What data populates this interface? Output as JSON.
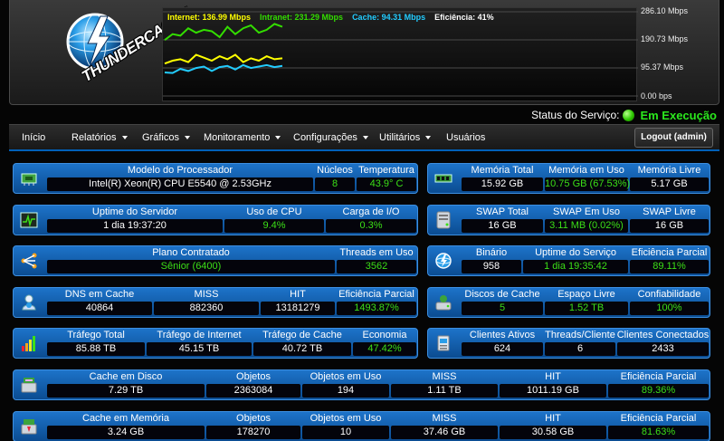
{
  "header": {
    "logo_text": "THUNDERCACHE",
    "graph": {
      "legend": [
        {
          "label": "Internet: 136.99 Mbps",
          "color": "#ffff00"
        },
        {
          "label": "Intranet: 231.29 Mbps",
          "color": "#33dd00"
        },
        {
          "label": "Cache: 94.31 Mbps",
          "color": "#22ccff"
        },
        {
          "label": "Eficiência: 41%",
          "color": "#ffffff"
        }
      ],
      "axis": [
        "286.10 Mbps",
        "190.73 Mbps",
        "95.37 Mbps",
        "0.00 bps"
      ]
    }
  },
  "chart_data": {
    "type": "line",
    "ylim": [
      0,
      286.1
    ],
    "yticks": [
      "286.10 Mbps",
      "190.73 Mbps",
      "95.37 Mbps",
      "0.00 bps"
    ],
    "x": [
      1,
      2,
      3,
      4,
      5,
      6,
      7,
      8,
      9,
      10,
      11,
      12,
      13,
      14,
      15,
      16
    ],
    "series": [
      {
        "name": "Intranet",
        "color": "#33dd00",
        "values": [
          190,
          210,
          205,
          230,
          215,
          225,
          220,
          200,
          235,
          210,
          230,
          240,
          215,
          225,
          245,
          235
        ]
      },
      {
        "name": "Internet",
        "color": "#ffff00",
        "values": [
          110,
          120,
          125,
          115,
          140,
          130,
          120,
          135,
          125,
          140,
          115,
          128,
          120,
          135,
          125,
          128
        ]
      },
      {
        "name": "Cache",
        "color": "#22ccff",
        "values": [
          80,
          78,
          92,
          85,
          95,
          100,
          85,
          98,
          102,
          90,
          105,
          95,
          100,
          105,
          98,
          102
        ]
      }
    ]
  },
  "status": {
    "label": "Status do Serviço:",
    "value": "Em Execução"
  },
  "nav": {
    "items": [
      "Início",
      "Relatórios",
      "Gráficos",
      "Monitoramento",
      "Configurações",
      "Utilitários",
      "Usuários"
    ],
    "logout": "Logout (admin)"
  },
  "panels": {
    "processor": {
      "model_h": "Modelo do Processador",
      "model_v": "Intel(R) Xeon(R) CPU E5540 @ 2.53GHz",
      "cores_h": "Núcleos",
      "cores_v": "8",
      "temp_h": "Temperatura",
      "temp_v": "43.9° C"
    },
    "memory": {
      "total_h": "Memória Total",
      "total_v": "15.92 GB",
      "used_h": "Memória em Uso",
      "used_v": "10.75 GB (67.53%)",
      "free_h": "Memória Livre",
      "free_v": "5.17 GB"
    },
    "uptime": {
      "uptime_h": "Uptime do Servidor",
      "uptime_v": "1 dia 19:37:20",
      "cpu_h": "Uso de CPU",
      "cpu_v": "9.4%",
      "io_h": "Carga de I/O",
      "io_v": "0.3%"
    },
    "swap": {
      "total_h": "SWAP Total",
      "total_v": "16 GB",
      "used_h": "SWAP Em Uso",
      "used_v": "3.11 MB (0.02%)",
      "free_h": "SWAP Livre",
      "free_v": "16 GB"
    },
    "plan": {
      "plan_h": "Plano Contratado",
      "plan_v": "Sênior (6400)",
      "threads_h": "Threads em Uso",
      "threads_v": "3562"
    },
    "binary": {
      "bin_h": "Binário",
      "bin_v": "958",
      "uptime_h": "Uptime do Serviço",
      "uptime_v": "1 dia 19:35:42",
      "eff_h": "Eficiência Parcial",
      "eff_v": "89.11%"
    },
    "dns": {
      "dns_h": "DNS em Cache",
      "dns_v": "40864",
      "miss_h": "MISS",
      "miss_v": "882360",
      "hit_h": "HIT",
      "hit_v": "13181279",
      "eff_h": "Eficiência Parcial",
      "eff_v": "1493.87%"
    },
    "disks": {
      "disks_h": "Discos de Cache",
      "disks_v": "5",
      "free_h": "Espaço Livre",
      "free_v": "1.52 TB",
      "rel_h": "Confiabilidade",
      "rel_v": "100%"
    },
    "traffic": {
      "total_h": "Tráfego Total",
      "total_v": "85.88 TB",
      "internet_h": "Tráfego de Internet",
      "internet_v": "45.15 TB",
      "cache_h": "Tráfego de Cache",
      "cache_v": "40.72 TB",
      "econ_h": "Economia",
      "econ_v": "47.42%"
    },
    "clients": {
      "active_h": "Clientes Ativos",
      "active_v": "624",
      "tpc_h": "Threads/Cliente",
      "tpc_v": "6",
      "conn_h": "Clientes Conectados",
      "conn_v": "2433"
    },
    "disk_cache": {
      "size_h": "Cache em Disco",
      "size_v": "7.29 TB",
      "obj_h": "Objetos",
      "obj_v": "2363084",
      "objuse_h": "Objetos em Uso",
      "objuse_v": "194",
      "miss_h": "MISS",
      "miss_v": "1.11 TB",
      "hit_h": "HIT",
      "hit_v": "1011.19 GB",
      "eff_h": "Eficiência Parcial",
      "eff_v": "89.36%"
    },
    "mem_cache": {
      "size_h": "Cache em Memória",
      "size_v": "3.24 GB",
      "obj_h": "Objetos",
      "obj_v": "178270",
      "objuse_h": "Objetos em Uso",
      "objuse_v": "10",
      "miss_h": "MISS",
      "miss_v": "37.46 GB",
      "hit_h": "HIT",
      "hit_v": "30.58 GB",
      "eff_h": "Eficiência Parcial",
      "eff_v": "81.63%"
    }
  }
}
